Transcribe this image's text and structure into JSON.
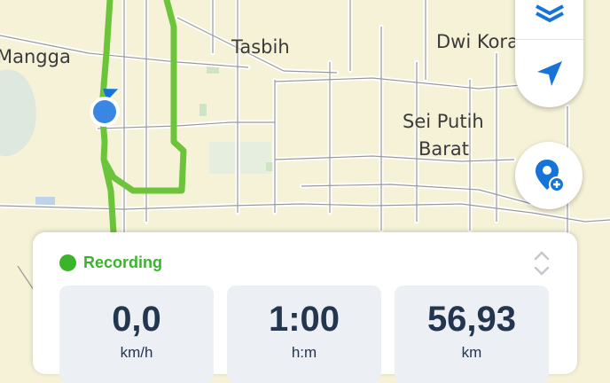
{
  "map": {
    "labels": [
      "Mangga",
      "Tasbih",
      "Dwi Kora",
      "Sei Putih",
      "Barat"
    ]
  },
  "colors": {
    "track": "#6cc43b",
    "accent": "#1673d8",
    "recording": "#3ab52a",
    "stat_text": "#22364f"
  },
  "controls": {
    "layers_icon": "layers-icon",
    "navigation_icon": "navigation-arrow-icon",
    "add_poi_icon": "add-poi-pin-icon"
  },
  "recording": {
    "status": "Recording",
    "expand_icon": "chevron-expand-icon"
  },
  "stats": [
    {
      "value": "0,0",
      "unit": "km/h"
    },
    {
      "value": "1:00",
      "unit": "h:m"
    },
    {
      "value": "56,93",
      "unit": "km"
    }
  ]
}
